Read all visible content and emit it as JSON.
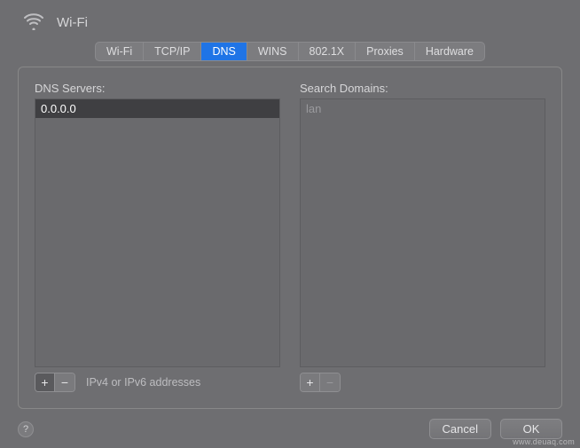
{
  "header": {
    "title": "Wi-Fi"
  },
  "tabs": [
    {
      "label": "Wi-Fi",
      "active": false
    },
    {
      "label": "TCP/IP",
      "active": false
    },
    {
      "label": "DNS",
      "active": true
    },
    {
      "label": "WINS",
      "active": false
    },
    {
      "label": "802.1X",
      "active": false
    },
    {
      "label": "Proxies",
      "active": false
    },
    {
      "label": "Hardware",
      "active": false
    }
  ],
  "dns": {
    "label": "DNS Servers:",
    "entries": [
      "0.0.0.0"
    ],
    "hint": "IPv4 or IPv6 addresses",
    "plus": "+",
    "minus": "−"
  },
  "search": {
    "label": "Search Domains:",
    "placeholder": "lan",
    "plus": "+",
    "minus": "−"
  },
  "footer": {
    "help": "?",
    "cancel": "Cancel",
    "ok": "OK"
  },
  "watermark": "www.deuaq.com"
}
